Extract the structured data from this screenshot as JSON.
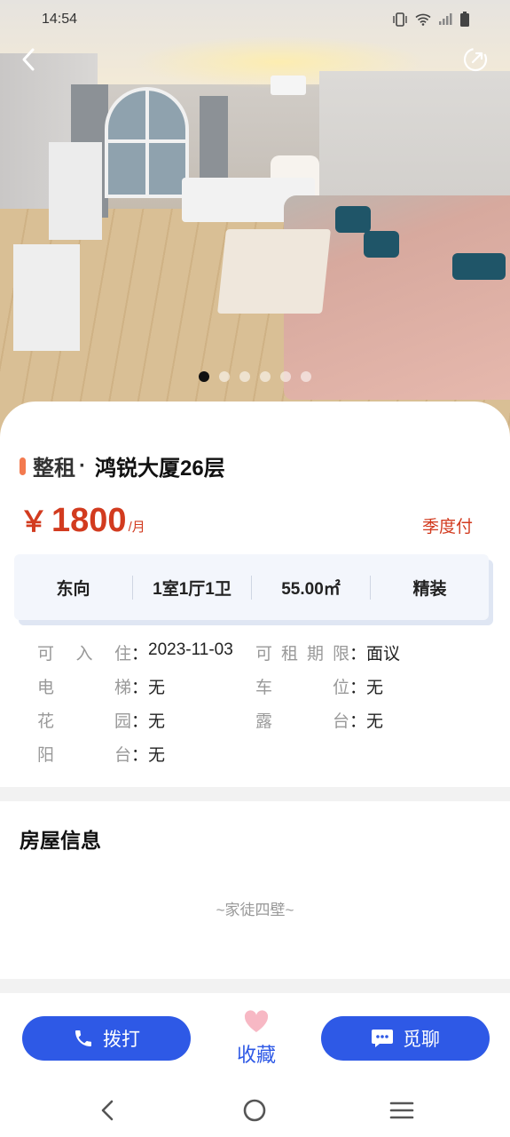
{
  "status_bar": {
    "time": "14:54"
  },
  "gallery": {
    "slide_count": 6,
    "active_index": 0
  },
  "listing": {
    "rent_type": "整租",
    "separator": "·",
    "name": "鸿锐大厦26层",
    "price_symbol": "￥",
    "price": "1800",
    "price_unit": "/月",
    "payment": "季度付",
    "specs": [
      "东向",
      "1室1厅1卫",
      "55.00㎡",
      "精装"
    ],
    "details": [
      {
        "label_chars": [
          "可",
          "入",
          "住"
        ],
        "colon": "：",
        "value": "2023-11-03"
      },
      {
        "label_chars": [
          "可",
          "租",
          "期",
          "限"
        ],
        "colon": "：",
        "value": "面议"
      },
      {
        "label_chars": [
          "电",
          "梯"
        ],
        "colon": "：",
        "value": "无"
      },
      {
        "label_chars": [
          "车",
          "位"
        ],
        "colon": "：",
        "value": "无"
      },
      {
        "label_chars": [
          "花",
          "园"
        ],
        "colon": "：",
        "value": "无"
      },
      {
        "label_chars": [
          "露",
          "台"
        ],
        "colon": "：",
        "value": "无"
      },
      {
        "label_chars": [
          "阳",
          "台"
        ],
        "colon": "：",
        "value": "无"
      }
    ]
  },
  "house_info": {
    "title": "房屋信息",
    "description": "~家徒四壁~"
  },
  "actions": {
    "call_label": "拨打",
    "favorite_label": "收藏",
    "chat_label": "觅聊"
  },
  "colors": {
    "accent_blue": "#2e59e6",
    "price_red": "#d23b1f",
    "title_mark": "#f37a4f",
    "favorite_heart": "#f7b8c4"
  }
}
